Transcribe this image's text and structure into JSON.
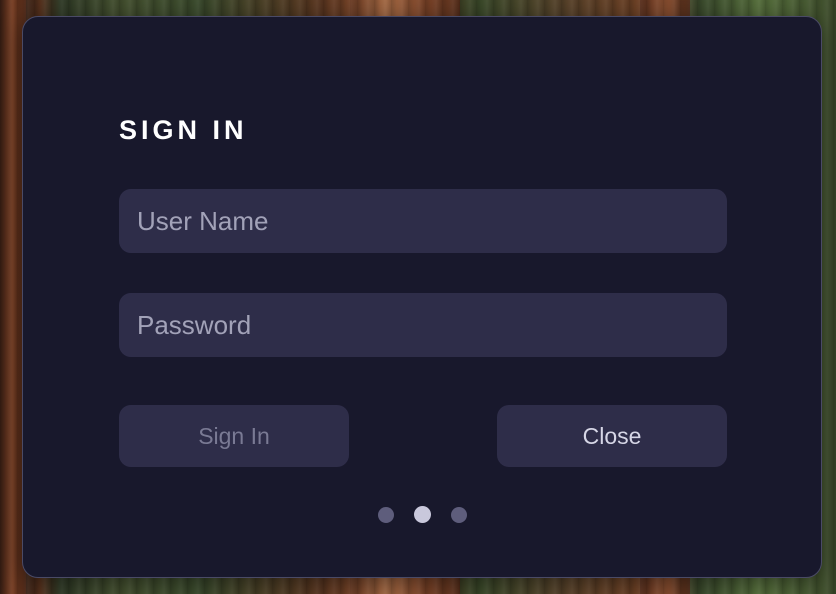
{
  "dialog": {
    "title": "SIGN IN",
    "username": {
      "placeholder": "User Name",
      "value": ""
    },
    "password": {
      "placeholder": "Password",
      "value": ""
    },
    "buttons": {
      "sign_in": "Sign In",
      "close": "Close"
    },
    "pagination": {
      "count": 3,
      "active_index": 1
    }
  },
  "colors": {
    "dialog_bg": "#18182c",
    "field_bg": "#2e2d49",
    "title": "#ffffff",
    "button_disabled_text": "#7a7a94",
    "button_text": "#d6d6e6",
    "dot_inactive": "#5e5d7c",
    "dot_active": "#c9c8dc"
  }
}
